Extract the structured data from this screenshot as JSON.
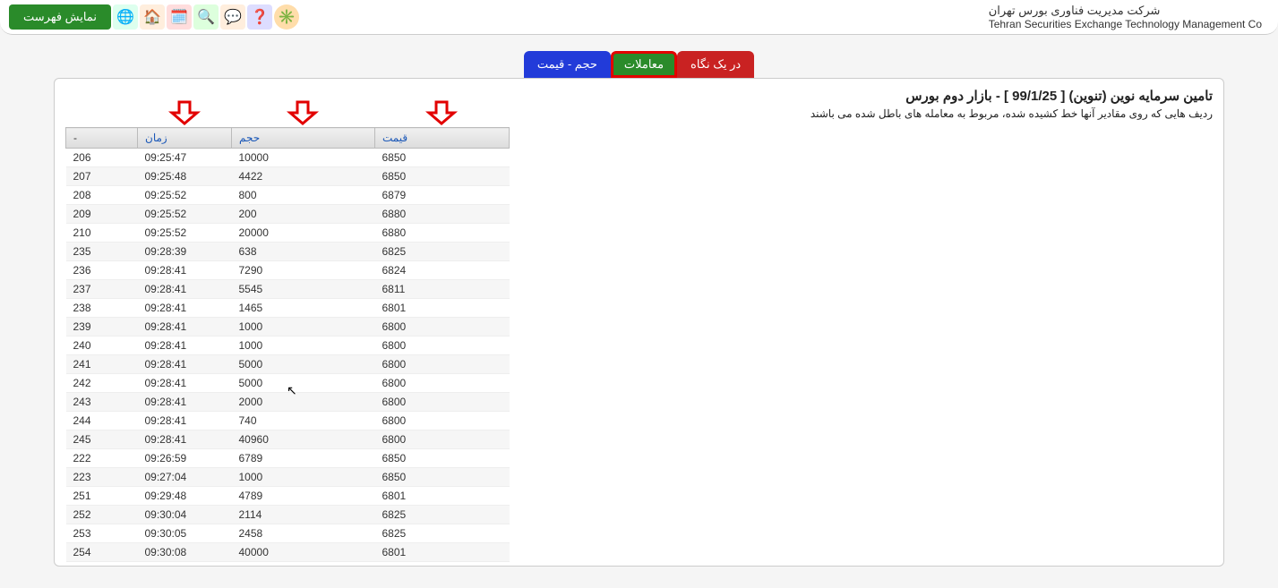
{
  "topbar": {
    "show_list": "نمایش فهرست"
  },
  "company": {
    "fa": "شرکت مدیریت فناوری بورس تهران",
    "en": "Tehran Securities Exchange Technology Management Co"
  },
  "tabs": {
    "volume_price": "حجم - قیمت",
    "trades": "معاملات",
    "glance": "در یک نگاه"
  },
  "page": {
    "title": "تامین سرمایه نوین (تنوین) [ 99/1/25 ] - بازار دوم بورس",
    "note": "ردیف هایی که روی مقادیر آنها خط کشیده شده، مربوط به معامله های باطل شده می باشند"
  },
  "columns": {
    "idx": "-",
    "time": "زمان",
    "volume": "حجم",
    "price": "قیمت"
  },
  "rows": [
    {
      "idx": "206",
      "time": "09:25:47",
      "volume": "10000",
      "price": "6850"
    },
    {
      "idx": "207",
      "time": "09:25:48",
      "volume": "4422",
      "price": "6850"
    },
    {
      "idx": "208",
      "time": "09:25:52",
      "volume": "800",
      "price": "6879"
    },
    {
      "idx": "209",
      "time": "09:25:52",
      "volume": "200",
      "price": "6880"
    },
    {
      "idx": "210",
      "time": "09:25:52",
      "volume": "20000",
      "price": "6880"
    },
    {
      "idx": "235",
      "time": "09:28:39",
      "volume": "638",
      "price": "6825"
    },
    {
      "idx": "236",
      "time": "09:28:41",
      "volume": "7290",
      "price": "6824"
    },
    {
      "idx": "237",
      "time": "09:28:41",
      "volume": "5545",
      "price": "6811"
    },
    {
      "idx": "238",
      "time": "09:28:41",
      "volume": "1465",
      "price": "6801"
    },
    {
      "idx": "239",
      "time": "09:28:41",
      "volume": "1000",
      "price": "6800"
    },
    {
      "idx": "240",
      "time": "09:28:41",
      "volume": "1000",
      "price": "6800"
    },
    {
      "idx": "241",
      "time": "09:28:41",
      "volume": "5000",
      "price": "6800"
    },
    {
      "idx": "242",
      "time": "09:28:41",
      "volume": "5000",
      "price": "6800"
    },
    {
      "idx": "243",
      "time": "09:28:41",
      "volume": "2000",
      "price": "6800"
    },
    {
      "idx": "244",
      "time": "09:28:41",
      "volume": "740",
      "price": "6800"
    },
    {
      "idx": "245",
      "time": "09:28:41",
      "volume": "40960",
      "price": "6800"
    },
    {
      "idx": "222",
      "time": "09:26:59",
      "volume": "6789",
      "price": "6850"
    },
    {
      "idx": "223",
      "time": "09:27:04",
      "volume": "1000",
      "price": "6850"
    },
    {
      "idx": "251",
      "time": "09:29:48",
      "volume": "4789",
      "price": "6801"
    },
    {
      "idx": "252",
      "time": "09:30:04",
      "volume": "2114",
      "price": "6825"
    },
    {
      "idx": "253",
      "time": "09:30:05",
      "volume": "2458",
      "price": "6825"
    },
    {
      "idx": "254",
      "time": "09:30:08",
      "volume": "40000",
      "price": "6801"
    }
  ]
}
